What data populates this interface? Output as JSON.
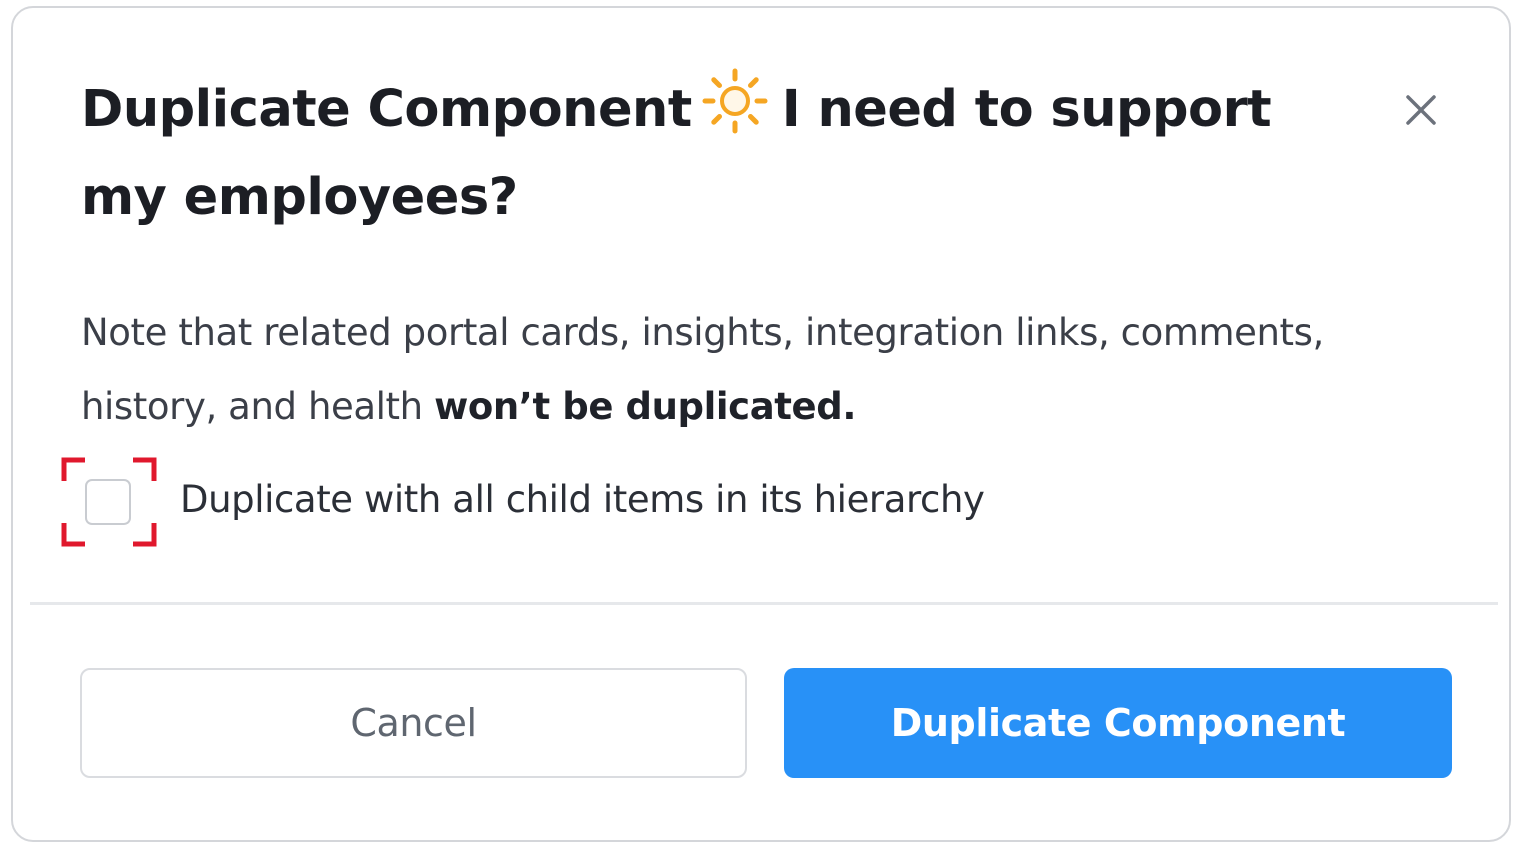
{
  "dialog": {
    "title_part1": "Duplicate Component",
    "title_icon": "sun-icon",
    "title_part2": "I need to support my employees?",
    "close_icon": "close-icon",
    "note_text": "Note that related portal cards, insights, integration links, comments, history, and health",
    "note_bold": "won’t be duplicated.",
    "checkbox": {
      "label": "Duplicate with all child items in its hierarchy",
      "checked": false,
      "focus_color": "#e0182d"
    },
    "buttons": {
      "cancel_label": "Cancel",
      "primary_label": "Duplicate Component"
    },
    "colors": {
      "primary": "#2891f7",
      "sun": "#f5a623"
    }
  }
}
